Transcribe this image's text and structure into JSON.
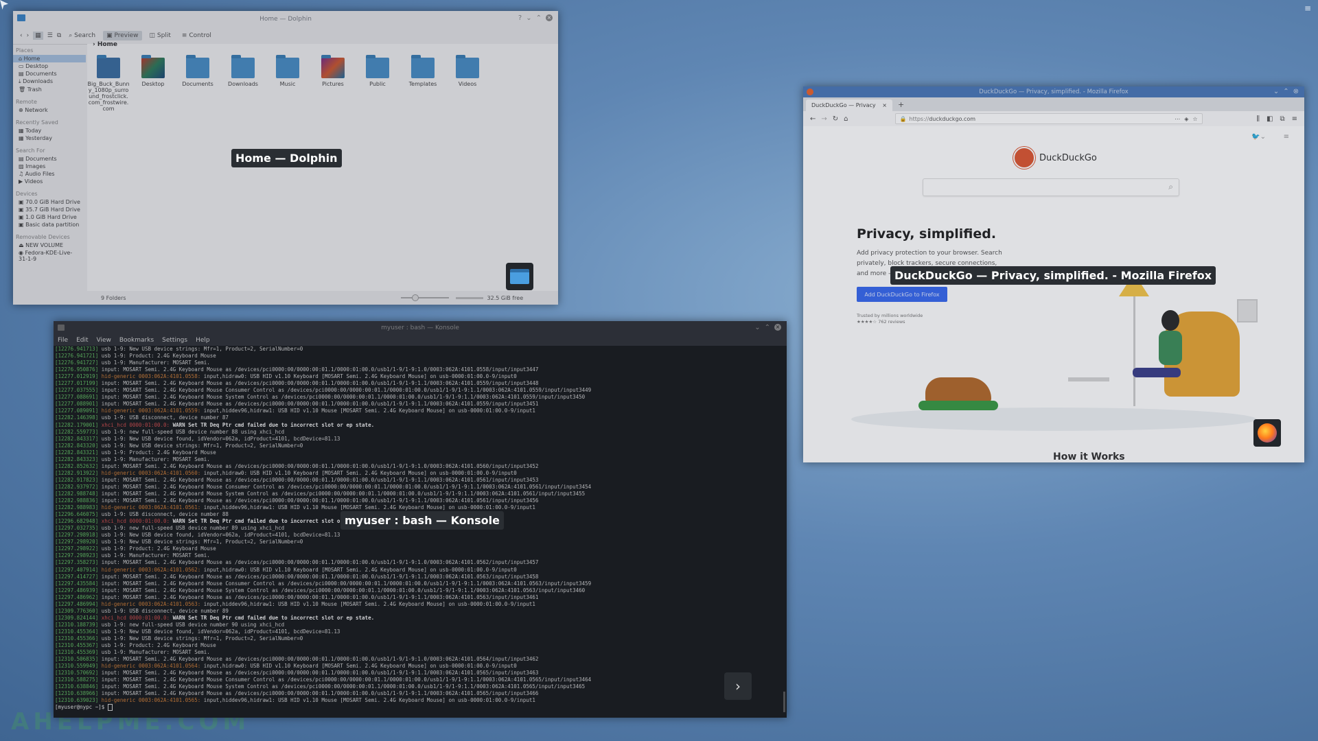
{
  "desktop": {
    "watermark": "AHELPME.COM"
  },
  "dolphin": {
    "window_title": "Home — Dolphin",
    "caption": "Home — Dolphin",
    "toolbar": {
      "search": "Search",
      "preview": "Preview",
      "split": "Split",
      "control": "Control"
    },
    "breadcrumb": "Home",
    "sidebar": {
      "places_header": "Places",
      "places": [
        "Home",
        "Desktop",
        "Documents",
        "Downloads",
        "Trash"
      ],
      "remote_header": "Remote",
      "remote": [
        "Network"
      ],
      "recent_header": "Recently Saved",
      "recent": [
        "Today",
        "Yesterday"
      ],
      "search_header": "Search For",
      "search": [
        "Documents",
        "Images",
        "Audio Files",
        "Videos"
      ],
      "devices_header": "Devices",
      "devices": [
        "70.0 GiB Hard Drive",
        "35.7 GiB Hard Drive",
        "1.0 GiB Hard Drive",
        "Basic data partition"
      ],
      "removable_header": "Removable Devices",
      "removable": [
        "NEW VOLUME",
        "Fedora-KDE-Live-31-1-9"
      ]
    },
    "files": [
      {
        "name": "Big_Buck_Bunny_1080p_surround_frostclick.com_frostwire.com"
      },
      {
        "name": "Desktop"
      },
      {
        "name": "Documents"
      },
      {
        "name": "Downloads"
      },
      {
        "name": "Music"
      },
      {
        "name": "Pictures"
      },
      {
        "name": "Public"
      },
      {
        "name": "Templates"
      },
      {
        "name": "Videos"
      }
    ],
    "status_left": "9 Folders",
    "status_right": "32.5 GiB free"
  },
  "konsole": {
    "window_title": "myuser : bash — Konsole",
    "caption": "myuser : bash — Konsole",
    "menu": [
      "File",
      "Edit",
      "View",
      "Bookmarks",
      "Settings",
      "Help"
    ],
    "prompt": "[myuser@nypc ~]$ ",
    "lines": [
      {
        "t": "[12276.941713]",
        "d": "usb 1-9:",
        "k": "usb",
        "m": "New USB device strings: Mfr=1, Product=2, SerialNumber=0"
      },
      {
        "t": "[12276.941721]",
        "d": "usb 1-9:",
        "k": "usb",
        "m": "Product: 2.4G Keyboard Mouse"
      },
      {
        "t": "[12276.941727]",
        "d": "usb 1-9:",
        "k": "usb",
        "m": "Manufacturer: MOSART Semi."
      },
      {
        "t": "[12276.950876]",
        "d": "input:",
        "k": "usb",
        "m": "MOSART Semi. 2.4G Keyboard Mouse as /devices/pci0000:00/0000:00:01.1/0000:01:00.0/usb1/1-9/1-9:1.0/0003:062A:4101.0558/input/input3447"
      },
      {
        "t": "[12277.012919]",
        "d": "hid-generic 0003:062A:4101.0558:",
        "k": "hid",
        "m": "input,hidraw0: USB HID v1.10 Keyboard [MOSART Semi. 2.4G Keyboard Mouse] on usb-0000:01:00.0-9/input0"
      },
      {
        "t": "[12277.017199]",
        "d": "input:",
        "k": "usb",
        "m": "MOSART Semi. 2.4G Keyboard Mouse as /devices/pci0000:00/0000:00:01.1/0000:01:00.0/usb1/1-9/1-9:1.1/0003:062A:4101.0559/input/input3448"
      },
      {
        "t": "[12277.037555]",
        "d": "input:",
        "k": "usb",
        "m": "MOSART Semi. 2.4G Keyboard Mouse Consumer Control as /devices/pci0000:00/0000:00:01.1/0000:01:00.0/usb1/1-9/1-9:1.1/0003:062A:4101.0559/input/input3449"
      },
      {
        "t": "[12277.088691]",
        "d": "input:",
        "k": "usb",
        "m": "MOSART Semi. 2.4G Keyboard Mouse System Control as /devices/pci0000:00/0000:00:01.1/0000:01:00.0/usb1/1-9/1-9:1.1/0003:062A:4101.0559/input/input3450"
      },
      {
        "t": "[12277.088901]",
        "d": "input:",
        "k": "usb",
        "m": "MOSART Semi. 2.4G Keyboard Mouse as /devices/pci0000:00/0000:00:01.1/0000:01:00.0/usb1/1-9/1-9:1.1/0003:062A:4101.0559/input/input3451"
      },
      {
        "t": "[12277.089091]",
        "d": "hid-generic 0003:062A:4101.0559:",
        "k": "hid",
        "m": "input,hiddev96,hidraw1: USB HID v1.10 Mouse [MOSART Semi. 2.4G Keyboard Mouse] on usb-0000:01:00.0-9/input1"
      },
      {
        "t": "[12282.146398]",
        "d": "usb 1-9:",
        "k": "usb",
        "m": "USB disconnect, device number 87"
      },
      {
        "t": "[12282.179001]",
        "d": "xhci_hcd 0000:01:00.0:",
        "k": "xhci",
        "m": "WARN Set TR Deq Ptr cmd failed due to incorrect slot or ep state.",
        "w": true
      },
      {
        "t": "[12282.559773]",
        "d": "usb 1-9:",
        "k": "usb",
        "m": "new full-speed USB device number 88 using xhci_hcd"
      },
      {
        "t": "[12282.843317]",
        "d": "usb 1-9:",
        "k": "usb",
        "m": "New USB device found, idVendor=062a, idProduct=4101, bcdDevice=81.13"
      },
      {
        "t": "[12282.843320]",
        "d": "usb 1-9:",
        "k": "usb",
        "m": "New USB device strings: Mfr=1, Product=2, SerialNumber=0"
      },
      {
        "t": "[12282.843321]",
        "d": "usb 1-9:",
        "k": "usb",
        "m": "Product: 2.4G Keyboard Mouse"
      },
      {
        "t": "[12282.843323]",
        "d": "usb 1-9:",
        "k": "usb",
        "m": "Manufacturer: MOSART Semi."
      },
      {
        "t": "[12282.852632]",
        "d": "input:",
        "k": "usb",
        "m": "MOSART Semi. 2.4G Keyboard Mouse as /devices/pci0000:00/0000:00:01.1/0000:01:00.0/usb1/1-9/1-9:1.0/0003:062A:4101.0560/input/input3452"
      },
      {
        "t": "[12282.913922]",
        "d": "hid-generic 0003:062A:4101.0560:",
        "k": "hid",
        "m": "input,hidraw0: USB HID v1.10 Keyboard [MOSART Semi. 2.4G Keyboard Mouse] on usb-0000:01:00.0-9/input0"
      },
      {
        "t": "[12282.917823]",
        "d": "input:",
        "k": "usb",
        "m": "MOSART Semi. 2.4G Keyboard Mouse as /devices/pci0000:00/0000:00:01.1/0000:01:00.0/usb1/1-9/1-9:1.1/0003:062A:4101.0561/input/input3453"
      },
      {
        "t": "[12282.937972]",
        "d": "input:",
        "k": "usb",
        "m": "MOSART Semi. 2.4G Keyboard Mouse Consumer Control as /devices/pci0000:00/0000:00:01.1/0000:01:00.0/usb1/1-9/1-9:1.1/0003:062A:4101.0561/input/input3454"
      },
      {
        "t": "[12282.988748]",
        "d": "input:",
        "k": "usb",
        "m": "MOSART Semi. 2.4G Keyboard Mouse System Control as /devices/pci0000:00/0000:00:01.1/0000:01:00.0/usb1/1-9/1-9:1.1/0003:062A:4101.0561/input/input3455"
      },
      {
        "t": "[12282.988836]",
        "d": "input:",
        "k": "usb",
        "m": "MOSART Semi. 2.4G Keyboard Mouse as /devices/pci0000:00/0000:00:01.1/0000:01:00.0/usb1/1-9/1-9:1.1/0003:062A:4101.0561/input/input3456"
      },
      {
        "t": "[12282.988983]",
        "d": "hid-generic 0003:062A:4101.0561:",
        "k": "hid",
        "m": "input,hiddev96,hidraw1: USB HID v1.10 Mouse [MOSART Semi. 2.4G Keyboard Mouse] on usb-0000:01:00.0-9/input1"
      },
      {
        "t": "[12296.646075]",
        "d": "usb 1-9:",
        "k": "usb",
        "m": "USB disconnect, device number 88"
      },
      {
        "t": "[12296.682948]",
        "d": "xhci_hcd 0000:01:00.0:",
        "k": "xhci",
        "m": "WARN Set TR Deq Ptr cmd failed due to incorrect slot or ep state.",
        "w": true
      },
      {
        "t": "[12297.032735]",
        "d": "usb 1-9:",
        "k": "usb",
        "m": "new full-speed USB device number 89 using xhci_hcd"
      },
      {
        "t": "[12297.298918]",
        "d": "usb 1-9:",
        "k": "usb",
        "m": "New USB device found, idVendor=062a, idProduct=4101, bcdDevice=81.13"
      },
      {
        "t": "[12297.298920]",
        "d": "usb 1-9:",
        "k": "usb",
        "m": "New USB device strings: Mfr=1, Product=2, SerialNumber=0"
      },
      {
        "t": "[12297.298922]",
        "d": "usb 1-9:",
        "k": "usb",
        "m": "Product: 2.4G Keyboard Mouse"
      },
      {
        "t": "[12297.298923]",
        "d": "usb 1-9:",
        "k": "usb",
        "m": "Manufacturer: MOSART Semi."
      },
      {
        "t": "[12297.358273]",
        "d": "input:",
        "k": "usb",
        "m": "MOSART Semi. 2.4G Keyboard Mouse as /devices/pci0000:00/0000:00:01.1/0000:01:00.0/usb1/1-9/1-9:1.0/0003:062A:4101.0562/input/input3457"
      },
      {
        "t": "[12297.407914]",
        "d": "hid-generic 0003:062A:4101.0562:",
        "k": "hid",
        "m": "input,hidraw0: USB HID v1.10 Keyboard [MOSART Semi. 2.4G Keyboard Mouse] on usb-0000:01:00.0-9/input0"
      },
      {
        "t": "[12297.414727]",
        "d": "input:",
        "k": "usb",
        "m": "MOSART Semi. 2.4G Keyboard Mouse as /devices/pci0000:00/0000:00:01.1/0000:01:00.0/usb1/1-9/1-9:1.1/0003:062A:4101.0563/input/input3458"
      },
      {
        "t": "[12297.435584]",
        "d": "input:",
        "k": "usb",
        "m": "MOSART Semi. 2.4G Keyboard Mouse Consumer Control as /devices/pci0000:00/0000:00:01.1/0000:01:00.0/usb1/1-9/1-9:1.1/0003:062A:4101.0563/input/input3459"
      },
      {
        "t": "[12297.486939]",
        "d": "input:",
        "k": "usb",
        "m": "MOSART Semi. 2.4G Keyboard Mouse System Control as /devices/pci0000:00/0000:00:01.1/0000:01:00.0/usb1/1-9/1-9:1.1/0003:062A:4101.0563/input/input3460"
      },
      {
        "t": "[12297.486962]",
        "d": "input:",
        "k": "usb",
        "m": "MOSART Semi. 2.4G Keyboard Mouse as /devices/pci0000:00/0000:00:01.1/0000:01:00.0/usb1/1-9/1-9:1.1/0003:062A:4101.0563/input/input3461"
      },
      {
        "t": "[12297.486994]",
        "d": "hid-generic 0003:062A:4101.0563:",
        "k": "hid",
        "m": "input,hiddev96,hidraw1: USB HID v1.10 Mouse [MOSART Semi. 2.4G Keyboard Mouse] on usb-0000:01:00.0-9/input1"
      },
      {
        "t": "[12309.776360]",
        "d": "usb 1-9:",
        "k": "usb",
        "m": "USB disconnect, device number 89"
      },
      {
        "t": "[12309.824144]",
        "d": "xhci_hcd 0000:01:00.0:",
        "k": "xhci",
        "m": "WARN Set TR Deq Ptr cmd failed due to incorrect slot or ep state.",
        "w": true
      },
      {
        "t": "[12310.188739]",
        "d": "usb 1-9:",
        "k": "usb",
        "m": "new full-speed USB device number 90 using xhci_hcd"
      },
      {
        "t": "[12310.455364]",
        "d": "usb 1-9:",
        "k": "usb",
        "m": "New USB device found, idVendor=062a, idProduct=4101, bcdDevice=81.13"
      },
      {
        "t": "[12310.455366]",
        "d": "usb 1-9:",
        "k": "usb",
        "m": "New USB device strings: Mfr=1, Product=2, SerialNumber=0"
      },
      {
        "t": "[12310.455367]",
        "d": "usb 1-9:",
        "k": "usb",
        "m": "Product: 2.4G Keyboard Mouse"
      },
      {
        "t": "[12310.455369]",
        "d": "usb 1-9:",
        "k": "usb",
        "m": "Manufacturer: MOSART Semi."
      },
      {
        "t": "[12310.506835]",
        "d": "input:",
        "k": "usb",
        "m": "MOSART Semi. 2.4G Keyboard Mouse as /devices/pci0000:00/0000:00:01.1/0000:01:00.0/usb1/1-9/1-9:1.0/0003:062A:4101.0564/input/input3462"
      },
      {
        "t": "[12310.559949]",
        "d": "hid-generic 0003:062A:4101.0564:",
        "k": "hid",
        "m": "input,hidraw0: USB HID v1.10 Keyboard [MOSART Semi. 2.4G Keyboard Mouse] on usb-0000:01:00.0-9/input0"
      },
      {
        "t": "[12310.570692]",
        "d": "input:",
        "k": "usb",
        "m": "MOSART Semi. 2.4G Keyboard Mouse as /devices/pci0000:00/0000:00:01.1/0000:01:00.0/usb1/1-9/1-9:1.1/0003:062A:4101.0565/input/input3463"
      },
      {
        "t": "[12310.588275]",
        "d": "input:",
        "k": "usb",
        "m": "MOSART Semi. 2.4G Keyboard Mouse Consumer Control as /devices/pci0000:00/0000:00:01.1/0000:01:00.0/usb1/1-9/1-9:1.1/0003:062A:4101.0565/input/input3464"
      },
      {
        "t": "[12310.638846]",
        "d": "input:",
        "k": "usb",
        "m": "MOSART Semi. 2.4G Keyboard Mouse System Control as /devices/pci0000:00/0000:00:01.1/0000:01:00.0/usb1/1-9/1-9:1.1/0003:062A:4101.0565/input/input3465"
      },
      {
        "t": "[12310.638966]",
        "d": "input:",
        "k": "usb",
        "m": "MOSART Semi. 2.4G Keyboard Mouse as /devices/pci0000:00/0000:00:01.1/0000:01:00.0/usb1/1-9/1-9:1.1/0003:062A:4101.0565/input/input3466"
      },
      {
        "t": "[12310.639023]",
        "d": "hid-generic 0003:062A:4101.0565:",
        "k": "hid",
        "m": "input,hiddev96,hidraw1: USB HID v1.10 Mouse [MOSART Semi. 2.4G Keyboard Mouse] on usb-0000:01:00.0-9/input1"
      }
    ]
  },
  "firefox": {
    "window_title": "DuckDuckGo — Privacy, simplified. - Mozilla Firefox",
    "caption": "DuckDuckGo — Privacy, simplified. - Mozilla Firefox",
    "tab_label": "DuckDuckGo — Privacy",
    "url_prefix": "https://",
    "url_domain": "duckduckgo.com",
    "brand": "DuckDuckGo",
    "headline": "Privacy, simplified.",
    "subtext": "Add privacy protection to your browser. Search privately, block trackers, secure connections, and more — all for free.",
    "cta": "Add DuckDuckGo to Firefox",
    "trusted": "Trusted by millions worldwide",
    "rating": "★★★★☆ 762 reviews",
    "how_it_works": "How it Works"
  },
  "colors": {
    "ddg_orange": "#de5833",
    "ddg_blue": "#3969ef",
    "terminal_green": "#5fb85f",
    "hid_orange": "#c87a36",
    "xhci_red": "#c84a4a",
    "ff_titlebar": "#4b79b8"
  }
}
